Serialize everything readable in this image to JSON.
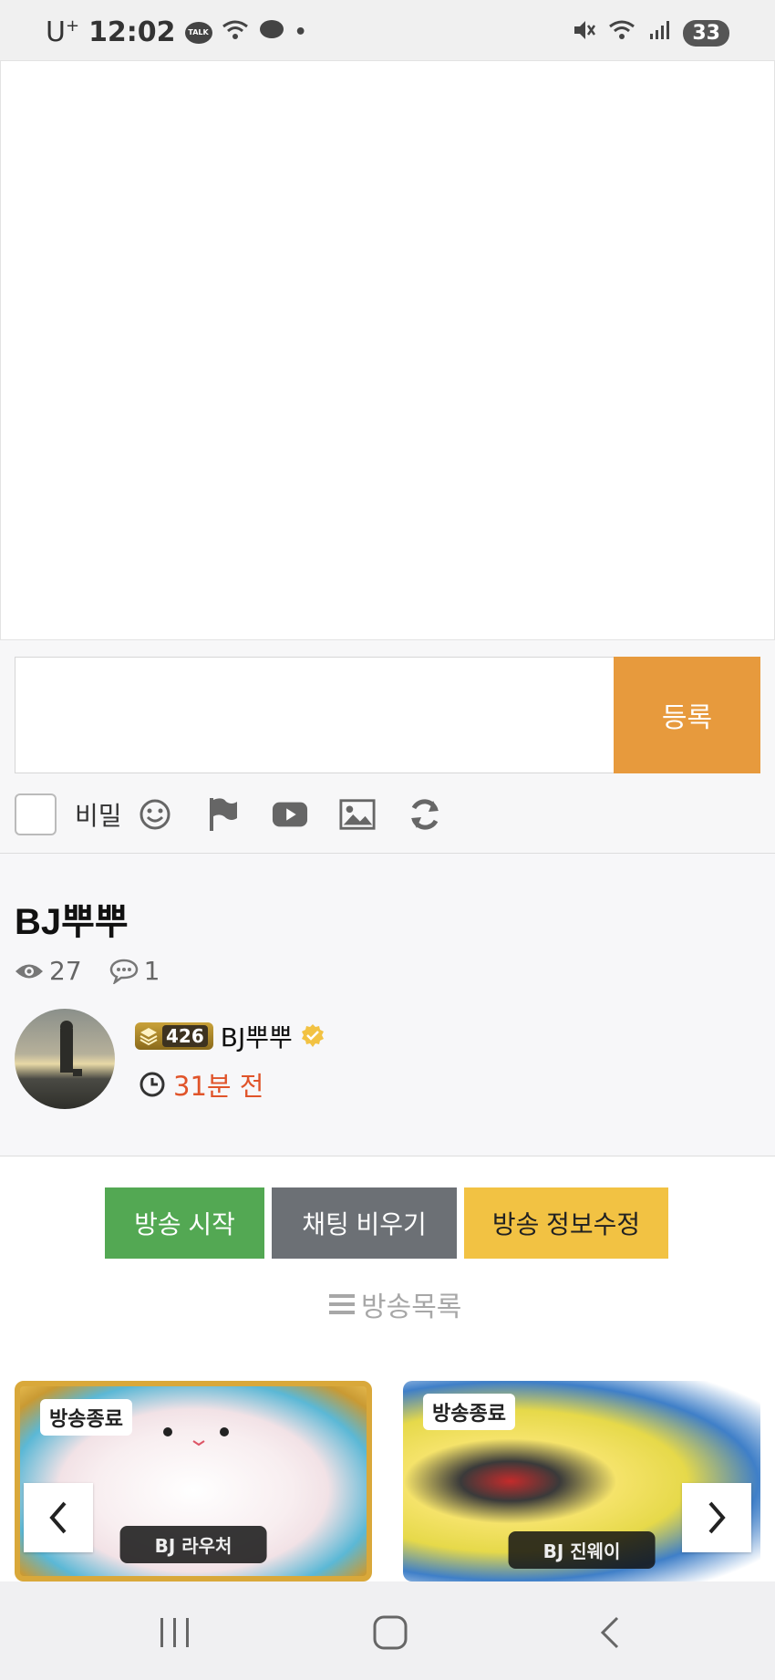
{
  "status_bar": {
    "carrier": "U",
    "carrier_sup": "+",
    "time": "12:02",
    "talk": "TALK",
    "battery": "33"
  },
  "comment": {
    "input_value": "",
    "submit_label": "등록",
    "secret_label": "비밀"
  },
  "post": {
    "title": "BJ뿌뿌",
    "views": "27",
    "comments": "1",
    "level": "426",
    "author": "BJ뿌뿌",
    "time_ago": "31분 전"
  },
  "actions": {
    "start_broadcast": "방송 시작",
    "clear_chat": "채팅 비우기",
    "edit_info": "방송 정보수정",
    "list_link": "방송목록"
  },
  "carousel": {
    "cards": [
      {
        "badge": "방송종료",
        "name": "BJ 라우처"
      },
      {
        "badge": "방송종료",
        "name": "BJ 진웨이"
      }
    ]
  },
  "colors": {
    "submit": "#e79a3d",
    "green": "#53a853",
    "gray": "#6c7075",
    "yellow": "#f2c243",
    "time": "#e0542a"
  }
}
